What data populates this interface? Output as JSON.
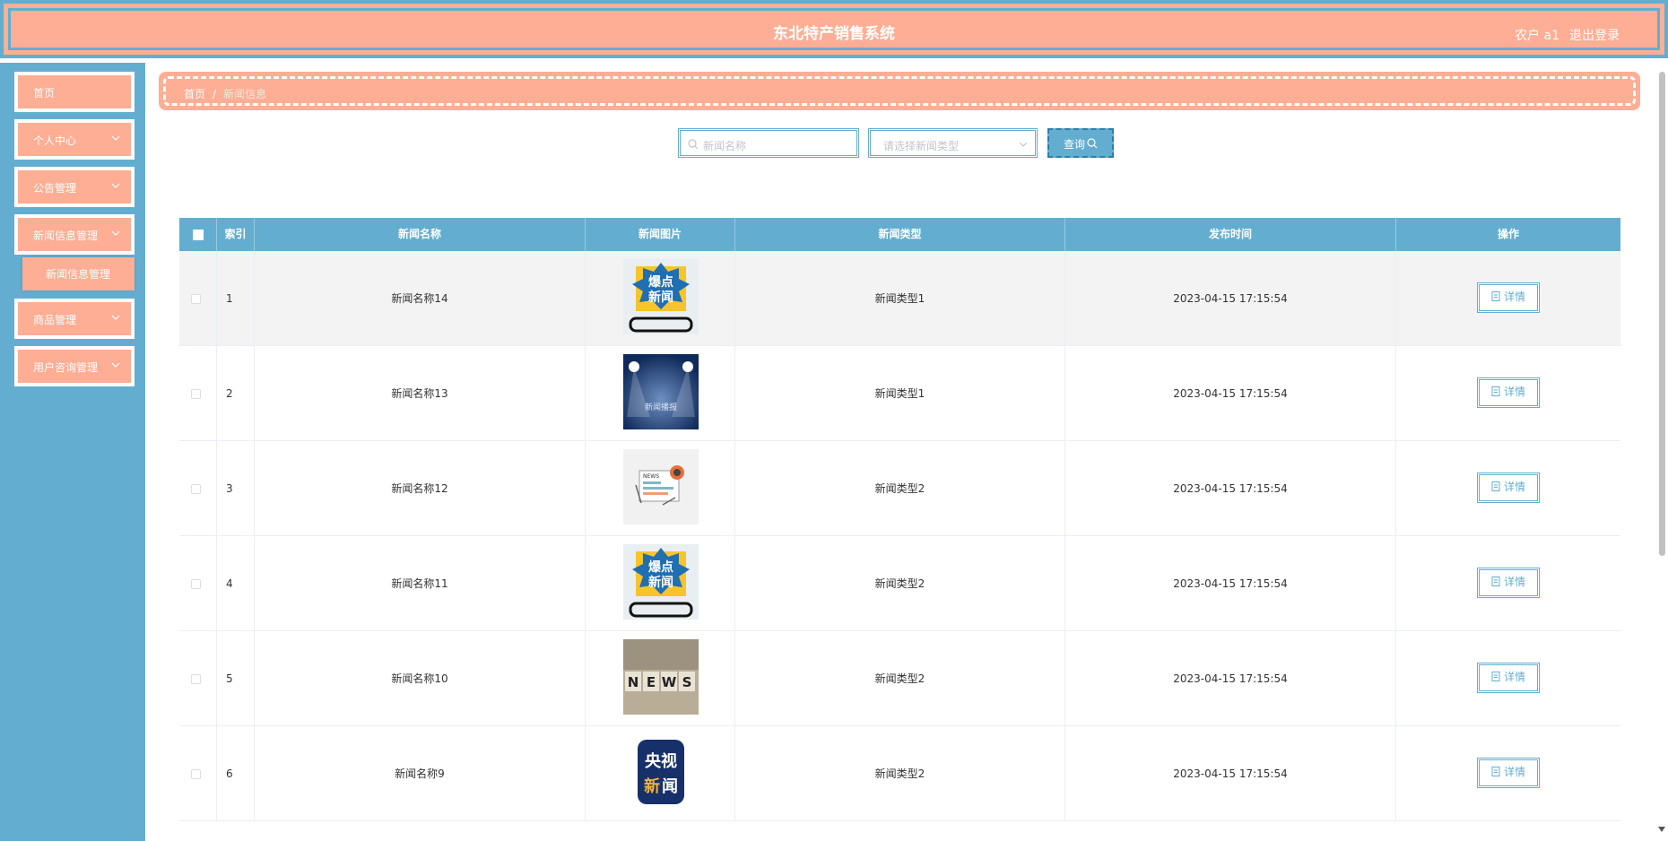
{
  "header": {
    "title": "东北特产销售系统",
    "user": "农户 a1",
    "logout": "退出登录"
  },
  "sidebar": {
    "items": [
      {
        "label": "首页"
      },
      {
        "label": "个人中心"
      },
      {
        "label": "公告管理"
      },
      {
        "label": "新闻信息管理"
      },
      {
        "label": "商品管理"
      },
      {
        "label": "用户咨询管理"
      }
    ],
    "submenu": {
      "label": "新闻信息管理"
    }
  },
  "breadcrumb": {
    "home": "首页",
    "separator": "/",
    "current": "新闻信息"
  },
  "search": {
    "name_placeholder": "新闻名称",
    "type_placeholder": "请选择新闻类型",
    "query_label": "查询"
  },
  "table": {
    "columns": [
      "索引",
      "新闻名称",
      "新闻图片",
      "新闻类型",
      "发布时间",
      "操作"
    ],
    "rows": [
      {
        "index": "1",
        "name": "新闻名称14",
        "type": "新闻类型1",
        "time": "2023-04-15 17:15:54",
        "image": "breaking-news-image",
        "action": "详情"
      },
      {
        "index": "2",
        "name": "新闻名称13",
        "type": "新闻类型1",
        "time": "2023-04-15 17:15:54",
        "image": "spotlight-news-image",
        "action": "详情"
      },
      {
        "index": "3",
        "name": "新闻名称12",
        "type": "新闻类型2",
        "time": "2023-04-15 17:15:54",
        "image": "newspaper-image",
        "action": "详情"
      },
      {
        "index": "4",
        "name": "新闻名称11",
        "type": "新闻类型2",
        "time": "2023-04-15 17:15:54",
        "image": "breaking-news-image",
        "action": "详情"
      },
      {
        "index": "5",
        "name": "新闻名称10",
        "type": "新闻类型2",
        "time": "2023-04-15 17:15:54",
        "image": "news-blocks-image",
        "action": "详情"
      },
      {
        "index": "6",
        "name": "新闻名称9",
        "type": "新闻类型2",
        "time": "2023-04-15 17:15:54",
        "image": "cctv-news-image",
        "action": "详情"
      }
    ]
  },
  "colors": {
    "primary": "#63aed0",
    "accent": "#fdae94"
  }
}
